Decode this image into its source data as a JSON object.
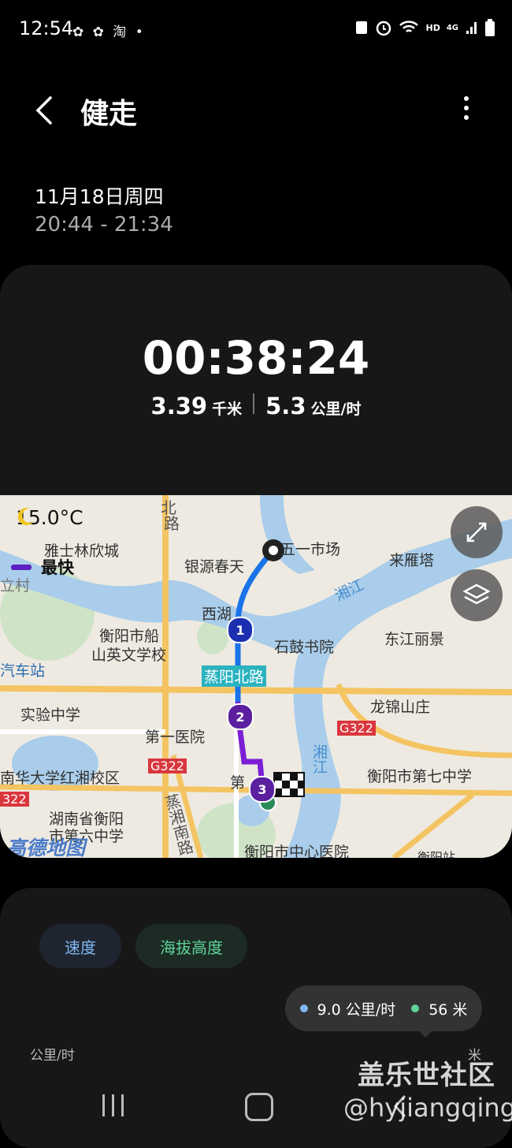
{
  "status_bar": {
    "time": "12:54",
    "app_icons_text": "✿ ✿ 淘 •",
    "network_label": "HD",
    "signal_label": "4G"
  },
  "header": {
    "title": "健走",
    "back_icon": "chevron-left-icon",
    "menu_icon": "more-vertical-icon"
  },
  "workout": {
    "date": "11月18日周四",
    "time_range": "20:44 - 21:34",
    "duration": "00:38:24",
    "distance_value": "3.39",
    "distance_unit": "千米",
    "speed_value": "5.3",
    "speed_unit": "公里/时"
  },
  "map": {
    "weather_icon": "moon-icon",
    "temperature": "15.0°C",
    "legend_label": "最快",
    "legend_color": "#5b1fc2",
    "route_colors": [
      "#1a73e8",
      "#7b1fd6"
    ],
    "markers": [
      "1",
      "2",
      "3"
    ],
    "labels": {
      "yashilin": "雅士林欣城",
      "yinyuan": "银源春天",
      "wuyi": "五一市场",
      "laiyan": "来雁塔",
      "xiangjiang": "湘江",
      "xihu": "西湖",
      "shigu": "石鼓书院",
      "dongjiang": "东江丽景",
      "hengyang_chuan": "衡阳市船",
      "shanying": "山英文学校",
      "zhengyang": "蒸阳北路",
      "longjin": "龙锦山庄",
      "bus": "汽车站",
      "shiyan": "实验中学",
      "diyi": "第一医院",
      "g322a": "G322",
      "g322b": "G322",
      "nanhua": "南华大学红湘校区",
      "hengyang7": "衡阳市第七中学",
      "di": "第",
      "hunan": "湖南省衡阳",
      "shi6": "市第六中学",
      "zhengxiang": "蒸湘南路",
      "zhongxin": "衡阳市中心医院",
      "hengyang_station": "衡阳站",
      "bei": "北",
      "lu": "路",
      "li_cun": "立村",
      "xiangjiang2": "湘江",
      "g322_edge": "322"
    },
    "logo_text": "高德地图"
  },
  "chart": {
    "tab_speed": "速度",
    "tab_altitude": "海拔高度",
    "tooltip_speed": "9.0 公里/时",
    "tooltip_altitude": "56 米",
    "speed_color": "#7fb8f0",
    "altitude_color": "#5fd39b",
    "y_unit_left": "公里/时",
    "y_unit_right": "米"
  },
  "watermark": {
    "line1": "盖乐世社区",
    "line2": "@hyjiangqing"
  }
}
